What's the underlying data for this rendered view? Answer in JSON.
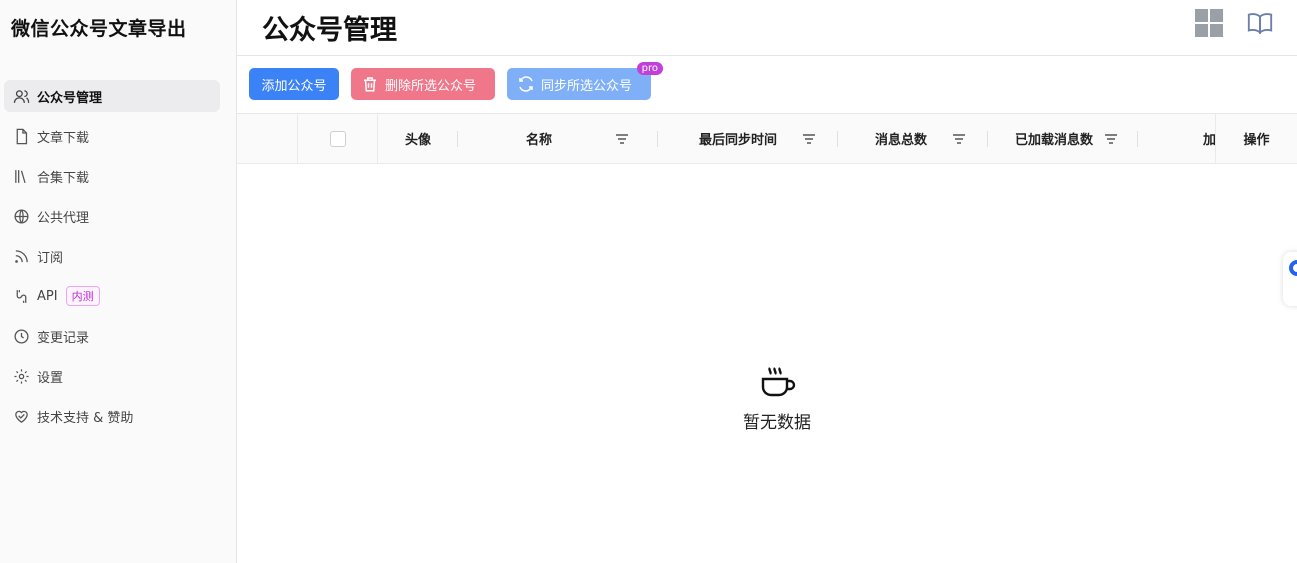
{
  "app": {
    "title": "微信公众号文章导出"
  },
  "sidebar": {
    "items": [
      {
        "label": "公众号管理",
        "icon": "user-icon",
        "active": true
      },
      {
        "label": "文章下载",
        "icon": "file-icon"
      },
      {
        "label": "合集下载",
        "icon": "library-icon"
      },
      {
        "label": "公共代理",
        "icon": "globe-icon"
      },
      {
        "label": "订阅",
        "icon": "rss-icon"
      },
      {
        "label": "API",
        "icon": "api-icon",
        "badge": "内测"
      },
      {
        "label": "变更记录",
        "icon": "clock-icon"
      },
      {
        "label": "设置",
        "icon": "gear-icon"
      },
      {
        "label": "技术支持 & 赞助",
        "icon": "heart-handshake-icon"
      }
    ]
  },
  "header": {
    "title": "公众号管理"
  },
  "toolbar": {
    "add_label": "添加公众号",
    "delete_label": "删除所选公众号",
    "sync_label": "同步所选公众号",
    "pro_tag": "pro"
  },
  "table": {
    "columns": [
      "头像",
      "名称",
      "最后同步时间",
      "消息总数",
      "已加载消息数",
      "加",
      "操作"
    ],
    "empty_text": "暂无数据"
  },
  "colors": {
    "primary": "#3b82f6",
    "danger": "#f0768a",
    "sync": "#7fb0f7",
    "pro": "#c23fd9",
    "beta": "#c026d3"
  }
}
